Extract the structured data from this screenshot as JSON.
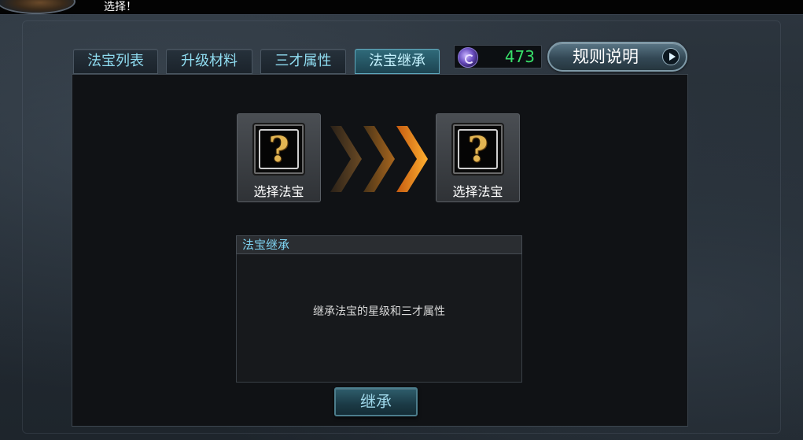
{
  "notice": {
    "text": "选择！"
  },
  "tabs": [
    {
      "label": "法宝列表",
      "active": false
    },
    {
      "label": "升级材料",
      "active": false
    },
    {
      "label": "三才属性",
      "active": false
    },
    {
      "label": "法宝继承",
      "active": true
    }
  ],
  "currency": {
    "value": "473",
    "icon": "purple-orb-icon",
    "color": "#38e06a"
  },
  "rules_button": {
    "label": "规则说明",
    "icon": "play-arrow-icon"
  },
  "slots": {
    "source": {
      "label": "选择法宝",
      "icon": "question-mark-icon"
    },
    "target": {
      "label": "选择法宝",
      "icon": "question-mark-icon"
    }
  },
  "transfer_arrows": {
    "icon": "chevron-right-icon",
    "count": 3
  },
  "description": {
    "title": "法宝继承",
    "body": "继承法宝的星级和三才属性"
  },
  "inherit_button": {
    "label": "继承"
  },
  "colors": {
    "accent": "#8fdcf0",
    "active_tab": "#2f6a7a",
    "arrow": "#f08a1c"
  }
}
